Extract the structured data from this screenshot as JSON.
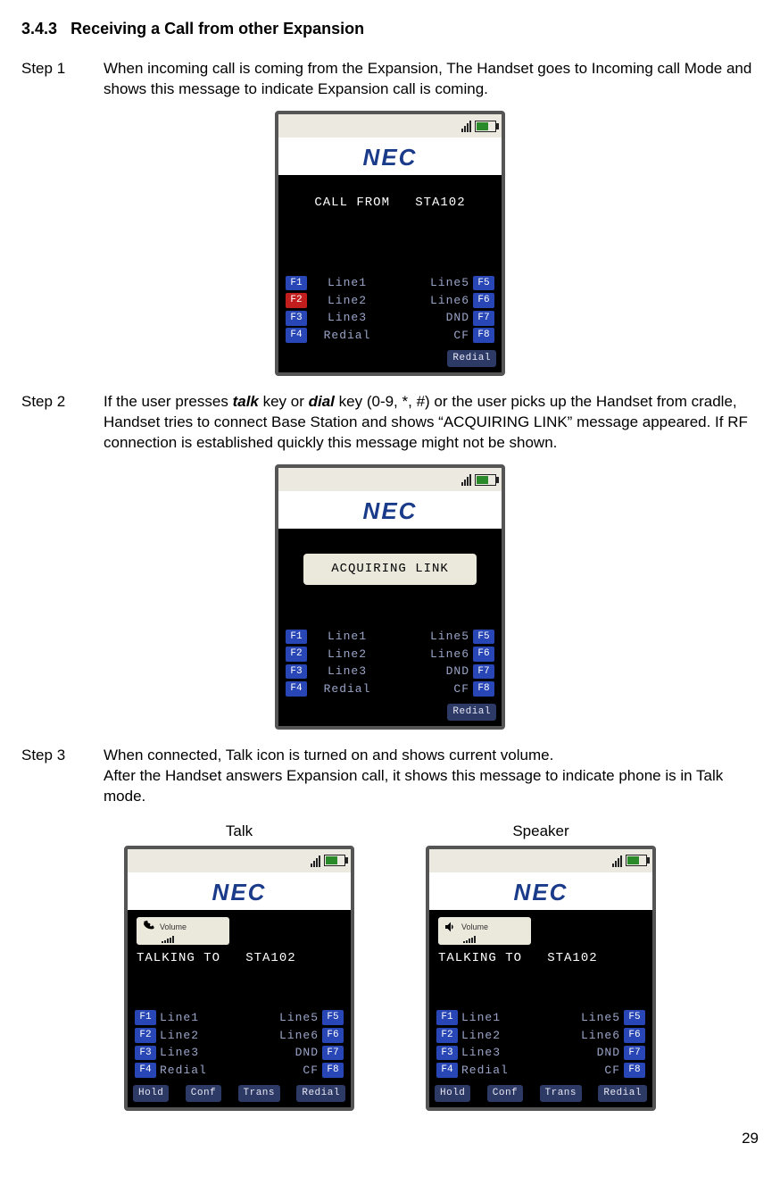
{
  "heading": {
    "num": "3.4.3",
    "title": "Receiving a Call from other Expansion"
  },
  "steps": {
    "s1": {
      "label": "Step 1",
      "text": "When incoming call is coming from the Expansion, The Handset goes to Incoming call Mode and shows this message to indicate Expansion call is coming."
    },
    "s2": {
      "label": "Step 2",
      "pre": "If the user presses ",
      "talk": "talk",
      "mid1": " key or ",
      "dial": "dial",
      "post": " key (0-9, *, #) or the user picks up the Handset from cradle, Handset tries to connect Base Station and shows “ACQUIRING LINK” message appeared. If RF connection is established quickly this message might not be shown."
    },
    "s3": {
      "label": "Step 3",
      "line1": "When connected, Talk icon is turned on and shows current volume.",
      "line2": "After the Handset answers Expansion call, it shows this message to indicate phone is in Talk mode."
    }
  },
  "pair": {
    "talk": "Talk",
    "speaker": "Speaker"
  },
  "logo": "NEC",
  "volume_label": "Volume",
  "phone1": {
    "msg": "CALL FROM   STA102",
    "f": {
      "l1": "Line1",
      "l2": "Line2",
      "l3": "Line3",
      "l4": "Redial",
      "r1": "Line5",
      "r2": "Line6",
      "r3": "DND",
      "r4": "CF",
      "t1": "F1",
      "t2": "F2",
      "t3": "F3",
      "t4": "F4",
      "t5": "F5",
      "t6": "F6",
      "t7": "F7",
      "t8": "F8"
    },
    "soft": {
      "redial": "Redial"
    }
  },
  "phone2": {
    "popup": "ACQUIRING LINK",
    "f": {
      "l1": "Line1",
      "l2": "Line2",
      "l3": "Line3",
      "l4": "Redial",
      "r1": "Line5",
      "r2": "Line6",
      "r3": "DND",
      "r4": "CF",
      "t1": "F1",
      "t2": "F2",
      "t3": "F3",
      "t4": "F4",
      "t5": "F5",
      "t6": "F6",
      "t7": "F7",
      "t8": "F8"
    },
    "soft": {
      "redial": "Redial"
    }
  },
  "phone3": {
    "msg": "TALKING TO   STA102",
    "f": {
      "l1": "Line1",
      "l2": "Line2",
      "l3": "Line3",
      "l4": "Redial",
      "r1": "Line5",
      "r2": "Line6",
      "r3": "DND",
      "r4": "CF",
      "t1": "F1",
      "t2": "F2",
      "t3": "F3",
      "t4": "F4",
      "t5": "F5",
      "t6": "F6",
      "t7": "F7",
      "t8": "F8"
    },
    "soft": {
      "hold": "Hold",
      "conf": "Conf",
      "trans": "Trans",
      "redial": "Redial"
    }
  },
  "phone4": {
    "msg": "TALKING TO   STA102",
    "f": {
      "l1": "Line1",
      "l2": "Line2",
      "l3": "Line3",
      "l4": "Redial",
      "r1": "Line5",
      "r2": "Line6",
      "r3": "DND",
      "r4": "CF",
      "t1": "F1",
      "t2": "F2",
      "t3": "F3",
      "t4": "F4",
      "t5": "F5",
      "t6": "F6",
      "t7": "F7",
      "t8": "F8"
    },
    "soft": {
      "hold": "Hold",
      "conf": "Conf",
      "trans": "Trans",
      "redial": "Redial"
    }
  },
  "page": "29"
}
